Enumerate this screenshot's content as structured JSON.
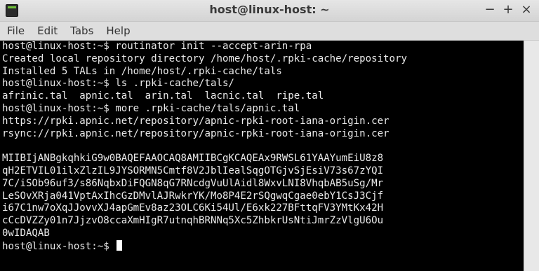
{
  "window": {
    "title": "host@linux-host: ~",
    "controls": {
      "minimize": "−",
      "maximize": "+",
      "close": "×"
    }
  },
  "menu": [
    "File",
    "Edit",
    "Tabs",
    "Help"
  ],
  "terminal": {
    "lines": [
      "host@linux-host:~$ routinator init --accept-arin-rpa",
      "Created local repository directory /home/host/.rpki-cache/repository",
      "Installed 5 TALs in /home/host/.rpki-cache/tals",
      "host@linux-host:~$ ls .rpki-cache/tals/",
      "afrinic.tal  apnic.tal  arin.tal  lacnic.tal  ripe.tal",
      "host@linux-host:~$ more .rpki-cache/tals/apnic.tal",
      "https://rpki.apnic.net/repository/apnic-rpki-root-iana-origin.cer",
      "rsync://rpki.apnic.net/repository/apnic-rpki-root-iana-origin.cer",
      "",
      "MIIBIjANBgkqhkiG9w0BAQEFAAOCAQ8AMIIBCgKCAQEAx9RWSL61YAAYumEiU8z8",
      "qH2ETVIL01ilxZlzIL9JYSORMN5Cmtf8V2JblIealSqgOTGjvSjEsiV73s67zYQI",
      "7C/iSOb96uf3/s86NqbxDiFQGN8qG7RNcdgVuUlAidl8WxvLNI8VhqbAB5uSg/Mr",
      "LeSOvXRja041VptAxIhcGzDMvlAJRwkrYK/Mo8P4E2rSQgwqCgae0ebY1CsJ3Cjf",
      "i67C1nw7oXqJJovvXJ4apGmEv8az23OLC6Ki54Ul/E6xk227BFttqFV3YMtKx42H",
      "cCcDVZZy01n7JjzvO8ccaXmHIgR7utnqhBRNNq5Xc5ZhbkrUsNtiJmrZzVlgU6Ou",
      "0wIDAQAB"
    ],
    "prompt": "host@linux-host:~$ "
  }
}
